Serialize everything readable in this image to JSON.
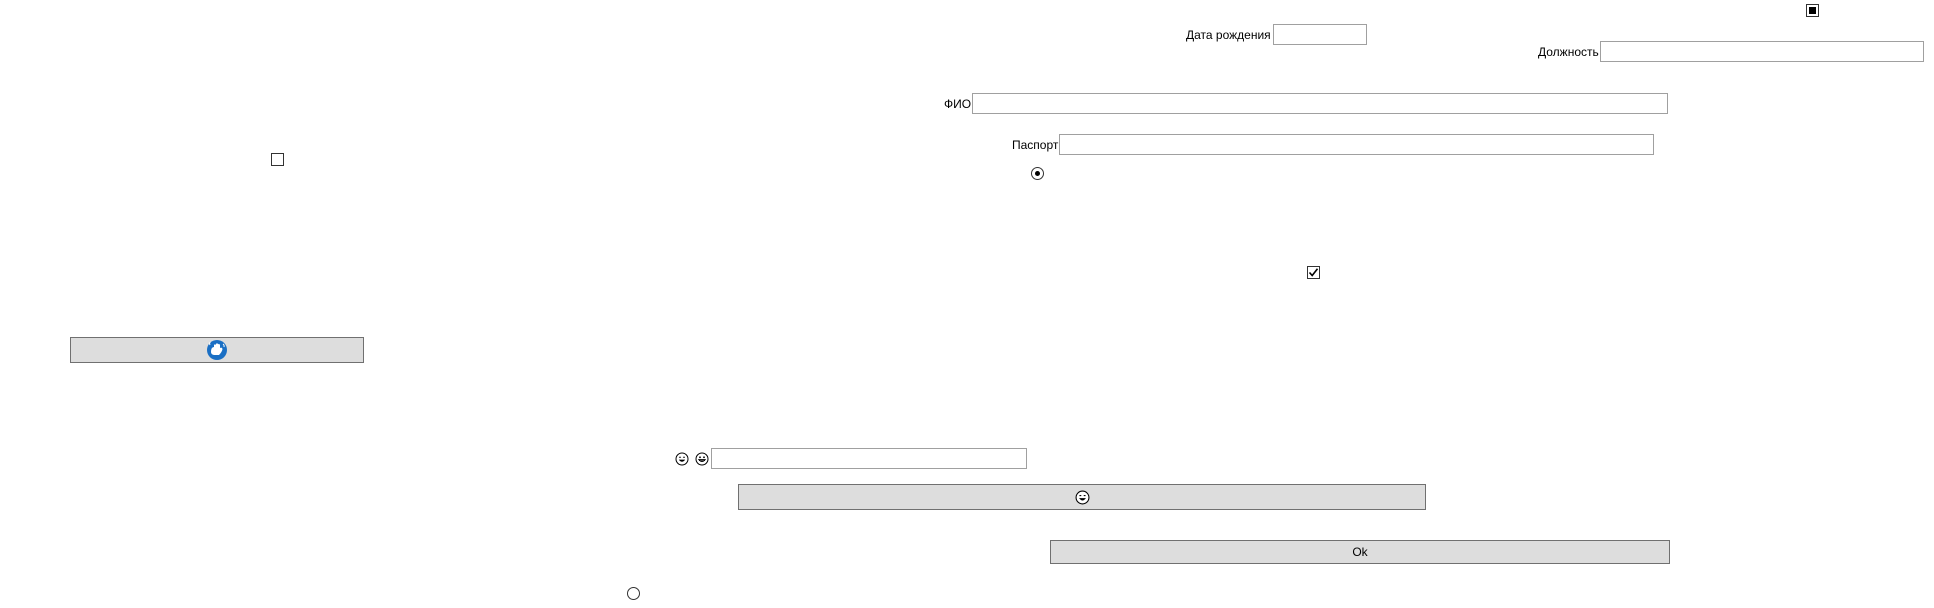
{
  "form": {
    "birth_date_label": "Дата рождения",
    "birth_date_value": "",
    "position_label": "Должность",
    "position_value": "",
    "fio_label": "ФИО",
    "fio_value": "",
    "passport_label": "Паспорт",
    "passport_value": "",
    "emoji_field_value": "",
    "ok_label": "Ok"
  },
  "controls": {
    "top_checkbox_state": "indeterminate",
    "left_checkbox_state": "unchecked",
    "middle_checkbox_state": "checked",
    "upper_radio_state": "selected",
    "lower_radio_state": "unselected"
  },
  "icons": {
    "left_button_icon": "waving-hand-icon",
    "emoji_1": "grinning-face-icon",
    "emoji_2": "smiling-face-icon",
    "wide_button_icon": "grinning-face-icon"
  },
  "colors": {
    "button_bg": "#dddddd",
    "accent_blue": "#1a6fc4"
  }
}
